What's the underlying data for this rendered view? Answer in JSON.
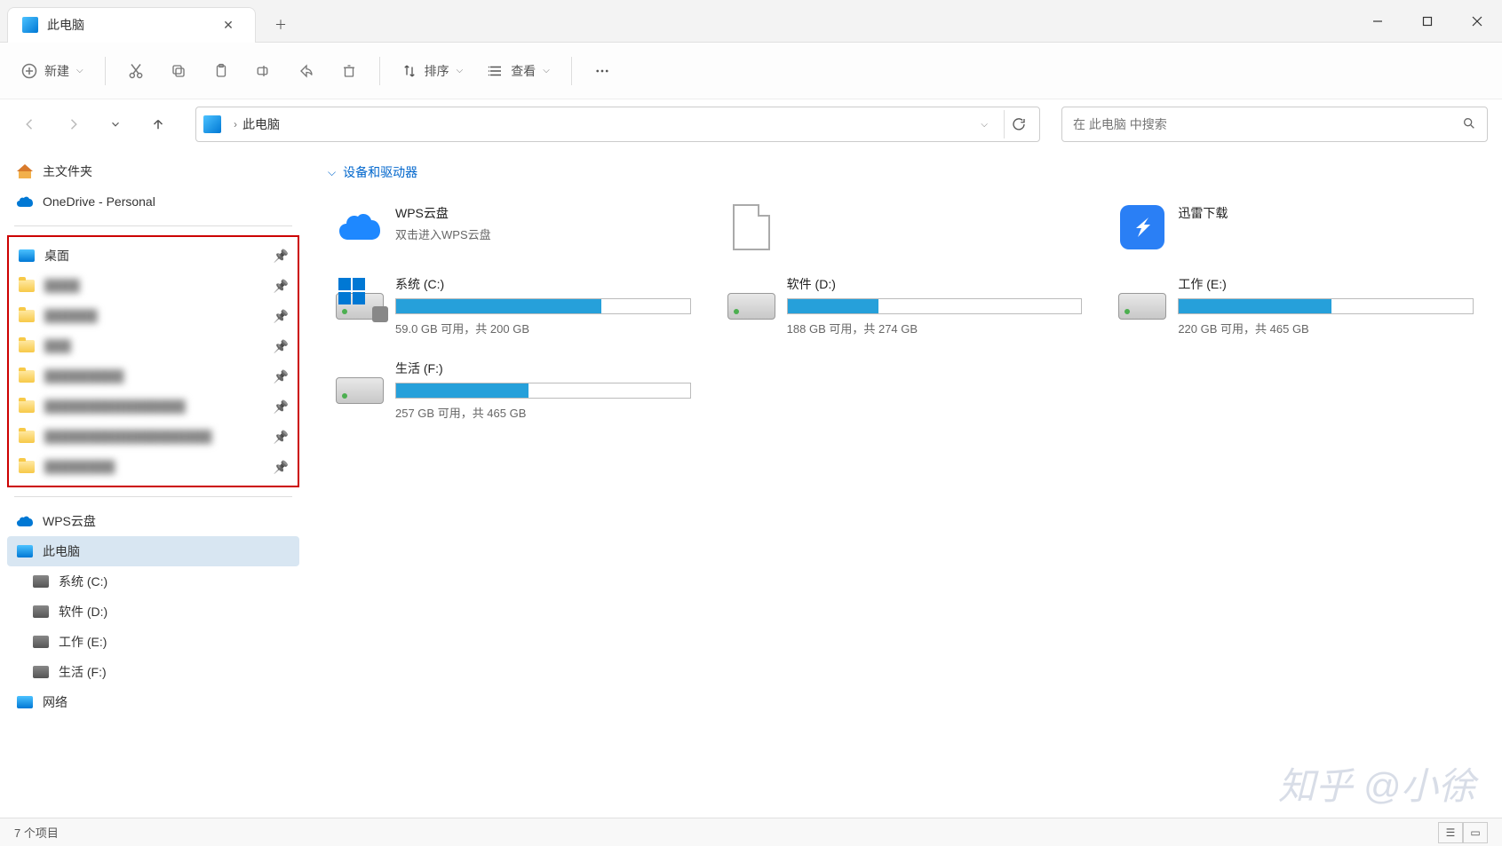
{
  "tab": {
    "title": "此电脑"
  },
  "toolbar": {
    "new": "新建",
    "sort": "排序",
    "view": "查看"
  },
  "nav": {
    "breadcrumb": "此电脑",
    "search_placeholder": "在 此电脑 中搜索"
  },
  "sidebar": {
    "home": "主文件夹",
    "onedrive": "OneDrive - Personal",
    "pinned": [
      {
        "label": "桌面",
        "icon": "desktop"
      },
      {
        "label": "████",
        "icon": "folder",
        "blur": true
      },
      {
        "label": "██████",
        "icon": "folder",
        "blur": true
      },
      {
        "label": "███",
        "icon": "folder",
        "blur": true
      },
      {
        "label": "█████████",
        "icon": "folder",
        "blur": true
      },
      {
        "label": "████████████████",
        "icon": "folder",
        "blur": true
      },
      {
        "label": "███████████████████",
        "icon": "folder",
        "blur": true
      },
      {
        "label": "████████",
        "icon": "folder",
        "blur": true
      }
    ],
    "wps": "WPS云盘",
    "thispc": "此电脑",
    "drives": [
      {
        "label": "系统 (C:)"
      },
      {
        "label": "软件 (D:)"
      },
      {
        "label": "工作 (E:)"
      },
      {
        "label": "生活 (F:)"
      }
    ],
    "network": "网络"
  },
  "content": {
    "group_header": "设备和驱动器",
    "items": [
      {
        "name": "WPS云盘",
        "sub": "双击进入WPS云盘",
        "kind": "wps"
      },
      {
        "name": "",
        "sub": "",
        "kind": "blankdoc"
      },
      {
        "name": "迅雷下载",
        "sub": "",
        "kind": "xunlei"
      },
      {
        "name": "系统 (C:)",
        "sub": "59.0 GB 可用，共 200 GB",
        "kind": "sysdrive",
        "fill": 70
      },
      {
        "name": "软件 (D:)",
        "sub": "188 GB 可用，共 274 GB",
        "kind": "drive",
        "fill": 31
      },
      {
        "name": "工作 (E:)",
        "sub": "220 GB 可用，共 465 GB",
        "kind": "drive",
        "fill": 52
      },
      {
        "name": "生活 (F:)",
        "sub": "257 GB 可用，共 465 GB",
        "kind": "drive",
        "fill": 45
      }
    ]
  },
  "status": {
    "text": "7 个项目"
  },
  "watermark": "知乎 @小徐"
}
